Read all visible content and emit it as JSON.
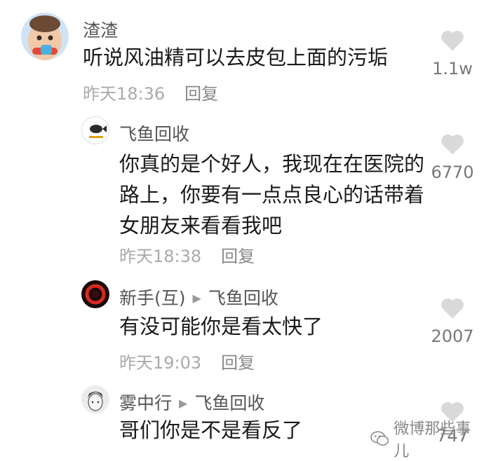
{
  "comments": [
    {
      "nickname": "渣渣",
      "text_lines": [
        "听说风油精可以去皮包上面的污垢"
      ],
      "time": "昨天18:36",
      "reply_label": "回复",
      "likes": "1.1w"
    },
    {
      "nickname": "飞鱼回收",
      "text_lines": [
        "你真的是个好人，我现在在医院的",
        "路上，你要有一点点良心的话带着",
        "女朋友来看看我吧"
      ],
      "time": "昨天18:38",
      "reply_label": "回复",
      "likes": "6770"
    },
    {
      "nickname": "新手(互)",
      "reply_to": "飞鱼回收",
      "text_lines": [
        "有没可能你是看太快了"
      ],
      "time": "昨天19:03",
      "reply_label": "回复",
      "likes": "2007"
    },
    {
      "nickname": "雾中行",
      "reply_to": "飞鱼回收",
      "text_lines": [
        "哥们你是不是看反了"
      ],
      "likes": "747"
    }
  ],
  "watermark": "微博那些事儿",
  "icons": {
    "like": "heart-icon",
    "reply_arrow": "triangle-right-icon",
    "watermark_logo": "wechat-icon"
  },
  "colors": {
    "like_heart": "#d9d9d9",
    "meta_text": "#aaaaaa"
  }
}
